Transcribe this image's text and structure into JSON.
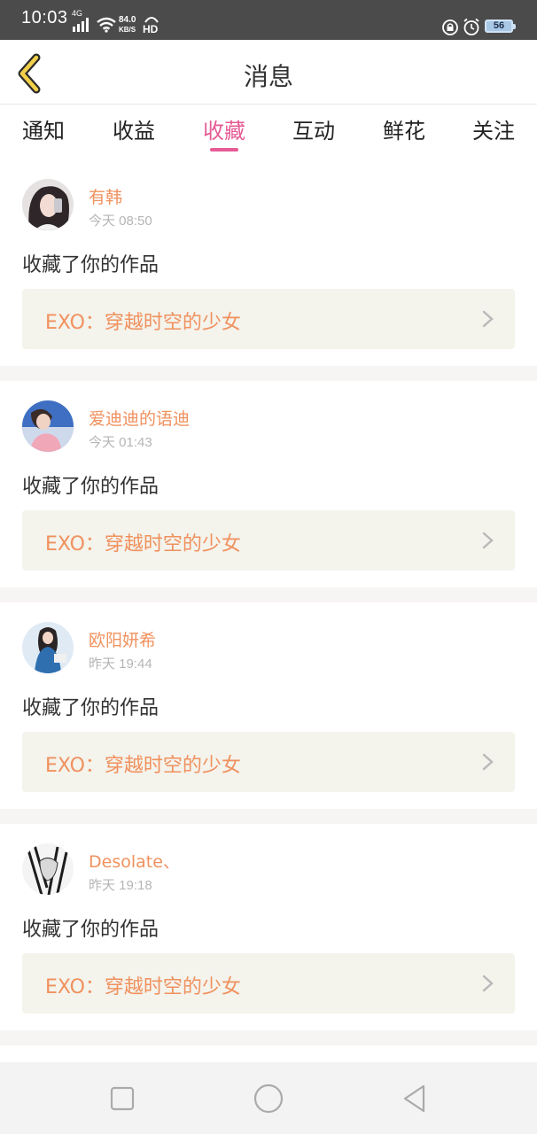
{
  "status_bar": {
    "time": "10:03",
    "network_type": "4G",
    "speed_value": "84.0",
    "speed_unit": "KB/S",
    "hd_label": "HD",
    "battery_level": "56"
  },
  "header": {
    "title": "消息",
    "back_icon": "chevron-left-icon"
  },
  "tabs": {
    "items": [
      {
        "label": "通知"
      },
      {
        "label": "收益"
      },
      {
        "label": "收藏"
      },
      {
        "label": "互动"
      },
      {
        "label": "鲜花"
      },
      {
        "label": "关注"
      }
    ],
    "active_label": "收藏",
    "active_color": "#e65b95"
  },
  "messages": [
    {
      "username": "有韩",
      "time": "今天 08:50",
      "action": "收藏了你的作品",
      "work_title": "EXO：穿越时空的少女"
    },
    {
      "username": "爱迪迪的语迪",
      "time": "今天 01:43",
      "action": "收藏了你的作品",
      "work_title": "EXO：穿越时空的少女"
    },
    {
      "username": "欧阳妍希",
      "time": "昨天 19:44",
      "action": "收藏了你的作品",
      "work_title": "EXO：穿越时空的少女"
    },
    {
      "username": "Desolate、",
      "time": "昨天 19:18",
      "action": "收藏了你的作品",
      "work_title": "EXO：穿越时空的少女"
    }
  ],
  "colors": {
    "accent_orange": "#f0915e",
    "link_background": "#f4f3ec",
    "status_bar": "#4b4b4b"
  },
  "navbar": {
    "items": [
      {
        "icon": "square-recents-icon"
      },
      {
        "icon": "circle-home-icon"
      },
      {
        "icon": "triangle-back-icon"
      }
    ]
  }
}
